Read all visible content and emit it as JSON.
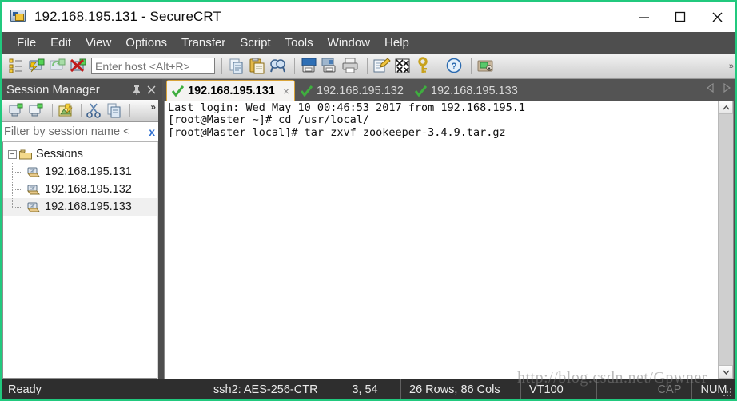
{
  "window": {
    "title": "192.168.195.131 - SecureCRT",
    "icon": "securecrt-app-icon",
    "minimize": "minimize-icon",
    "maximize": "maximize-icon",
    "close": "close-icon"
  },
  "menubar": {
    "items": [
      {
        "label": "File"
      },
      {
        "label": "Edit"
      },
      {
        "label": "View"
      },
      {
        "label": "Options"
      },
      {
        "label": "Transfer"
      },
      {
        "label": "Script"
      },
      {
        "label": "Tools"
      },
      {
        "label": "Window"
      },
      {
        "label": "Help"
      }
    ]
  },
  "toolbar": {
    "host_placeholder": "Enter host <Alt+R>",
    "host_value": "",
    "overflow": "»",
    "icons": [
      {
        "name": "session-manager-icon"
      },
      {
        "name": "connect-icon"
      },
      {
        "name": "reconnect-icon"
      },
      {
        "name": "disconnect-icon"
      },
      {
        "name": "copy-icon"
      },
      {
        "name": "paste-icon"
      },
      {
        "name": "find-icon"
      },
      {
        "name": "print-screen-icon"
      },
      {
        "name": "log-session-icon"
      },
      {
        "name": "print-icon"
      },
      {
        "name": "edit-default-session-icon"
      },
      {
        "name": "chat-window-icon"
      },
      {
        "name": "key-icon"
      },
      {
        "name": "help-icon"
      },
      {
        "name": "secure-shell-icon"
      }
    ]
  },
  "session_manager": {
    "title": "Session Manager",
    "pin": "pin-icon",
    "close": "close-icon",
    "toolbar_icons": [
      {
        "name": "new-session-icon"
      },
      {
        "name": "new-folder-icon"
      },
      {
        "name": "properties-icon"
      },
      {
        "name": "cut-icon"
      },
      {
        "name": "copy-icon"
      }
    ],
    "toolbar_overflow": "»",
    "filter_placeholder": "Filter by session name <",
    "filter_clear": "x",
    "tree": {
      "root": {
        "label": "Sessions",
        "expander": "−",
        "expanded": true
      },
      "children": [
        {
          "label": "192.168.195.131",
          "selected": false
        },
        {
          "label": "192.168.195.132",
          "selected": false
        },
        {
          "label": "192.168.195.133",
          "selected": true
        }
      ]
    }
  },
  "tabs": {
    "items": [
      {
        "label": "192.168.195.131",
        "active": true,
        "status": "connected",
        "close": "×"
      },
      {
        "label": "192.168.195.132",
        "active": false,
        "status": "connected"
      },
      {
        "label": "192.168.195.133",
        "active": false,
        "status": "connected"
      }
    ],
    "nav_prev": "tab-prev-icon",
    "nav_next": "tab-next-icon"
  },
  "terminal": {
    "lines": [
      "Last login: Wed May 10 00:46:53 2017 from 192.168.195.1",
      "[root@Master ~]# cd /usr/local/",
      "[root@Master local]# tar zxvf zookeeper-3.4.9.tar.gz"
    ],
    "scroll_up": "scroll-up-icon",
    "scroll_down": "scroll-down-icon"
  },
  "statusbar": {
    "ready": "Ready",
    "protocol": "ssh2: AES-256-CTR",
    "cursor": "3, 54",
    "size": "26 Rows, 86 Cols",
    "emulation": "VT100",
    "cap": "CAP",
    "num": "NUM"
  },
  "watermark": "http://blog.csdn.net/Gpwner",
  "colors": {
    "window_border": "#21c97e",
    "chrome": "#4e4e4e",
    "active_tab_border": "#d9a43a",
    "status_bg": "#2e2e2e",
    "terminal_bg": "#ffffff",
    "check_green": "#3fae3f"
  }
}
